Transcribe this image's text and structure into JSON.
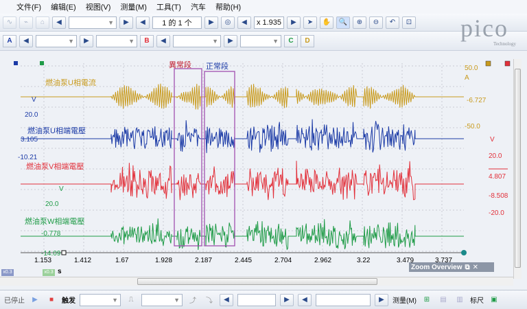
{
  "menu": [
    "文件(F)",
    "编辑(E)",
    "视图(V)",
    "测量(M)",
    "工具(T)",
    "汽车",
    "帮助(H)"
  ],
  "toolbar": {
    "page_label": "1 的 1 个",
    "zoom_value": "x 1.935",
    "channel_a": "A",
    "channel_b": "B",
    "channel_c": "C",
    "channel_d": "D"
  },
  "logo": {
    "word": "pico",
    "sub": "Technology"
  },
  "annotations": {
    "abnormal": "異常段",
    "normal": "正常段"
  },
  "colors": {
    "yellow": "#c89a1c",
    "blue": "#1b3aa6",
    "red": "#e2303a",
    "green": "#1f9b47",
    "box": "#a050b0"
  },
  "chart_data": {
    "type": "line",
    "x_unit": "s",
    "x_ticks": [
      "1.153",
      "1.412",
      "1.67",
      "1.928",
      "2.187",
      "2.445",
      "2.704",
      "2.962",
      "3.22",
      "3.479",
      "3.737"
    ],
    "series": [
      {
        "name": "燃油泵U相電流",
        "color": "#c89a1c",
        "scale_label": "A",
        "top_value": "50.0",
        "bottom_value": "-6.727"
      },
      {
        "name": "燃油泵U相端電壓",
        "color": "#1b3aa6",
        "scale_label": "V",
        "top_value": "20.0",
        "bottom_value": "3.105"
      },
      {
        "name": "燃油泵V相端電壓",
        "color": "#e2303a",
        "scale_label": "V",
        "top_value": "20.0",
        "mid_value": "4.807",
        "bottom_value": "-8.508"
      },
      {
        "name": "燃油泵W相端電壓",
        "color": "#1f9b47",
        "scale_label": "V",
        "top_value": "20.0",
        "bottom_value": "-0.778"
      }
    ],
    "left_axis": {
      "a_top": "20.0",
      "a_bottom": "-10.21",
      "w_bottom": "-14.09"
    },
    "right_axis": {
      "blue_top": "-50.0",
      "w_top": "-20.0"
    }
  },
  "zoom_overview": {
    "title": "Zoom Overview"
  },
  "scroll_labels": {
    "x1": "x0.3",
    "x2": "x0.3",
    "unit": "s"
  },
  "statusbar": {
    "stop_label": "已停止",
    "trigger_label": "触发",
    "measure_label": "测量(M)",
    "ruler_label": "标尺"
  }
}
